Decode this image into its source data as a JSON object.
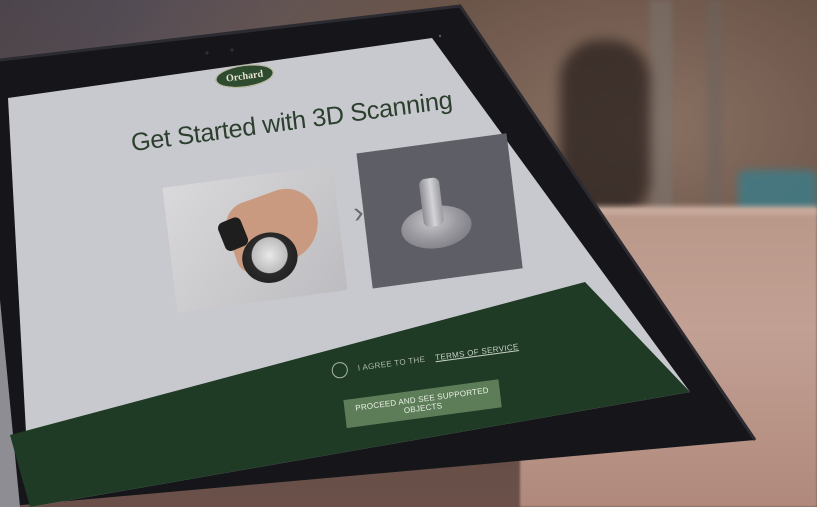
{
  "brand": {
    "logo_text": "Orchard"
  },
  "page": {
    "title": "Get Started with 3D Scanning"
  },
  "agreement": {
    "prefix": "I AGREE TO THE",
    "link_text": "TERMS OF SERVICE",
    "checked": false
  },
  "actions": {
    "proceed_label": "PROCEED AND SEE SUPPORTED OBJECTS"
  },
  "icons": {
    "arrow": "chevron-right-icon",
    "radio": "radio-unchecked-icon"
  },
  "colors": {
    "screen_light": "#c8c9ce",
    "screen_dark_green": "#1f3a25",
    "button_green": "#5d7d58",
    "title_text": "#2c3f2e"
  }
}
